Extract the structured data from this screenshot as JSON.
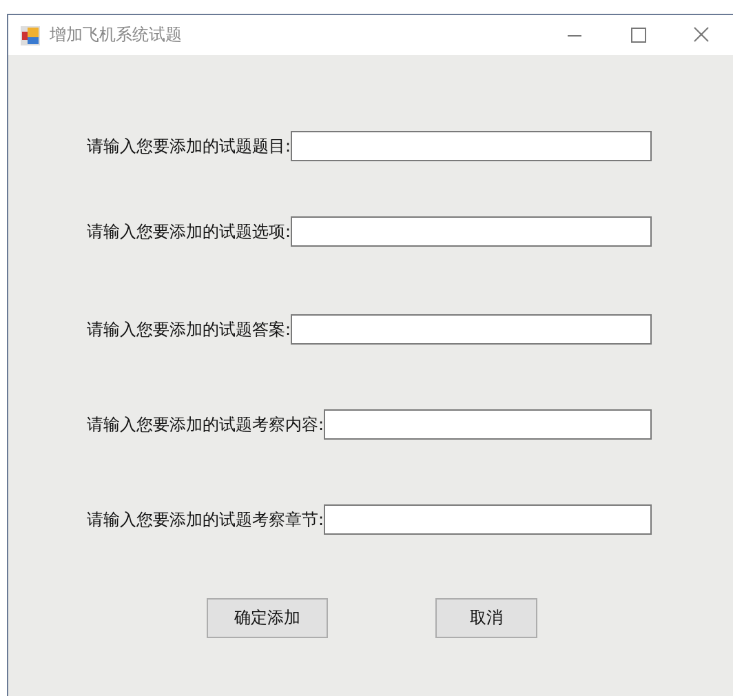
{
  "window": {
    "title": "增加飞机系统试题"
  },
  "fields": [
    {
      "label": "请输入您要添加的试题题目:"
    },
    {
      "label": "请输入您要添加的试题选项:"
    },
    {
      "label": "请输入您要添加的试题答案:"
    },
    {
      "label": "请输入您要添加的试题考察内容:"
    },
    {
      "label": "请输入您要添加的试题考察章节:"
    }
  ],
  "buttons": [
    "确定添加",
    "取消"
  ]
}
